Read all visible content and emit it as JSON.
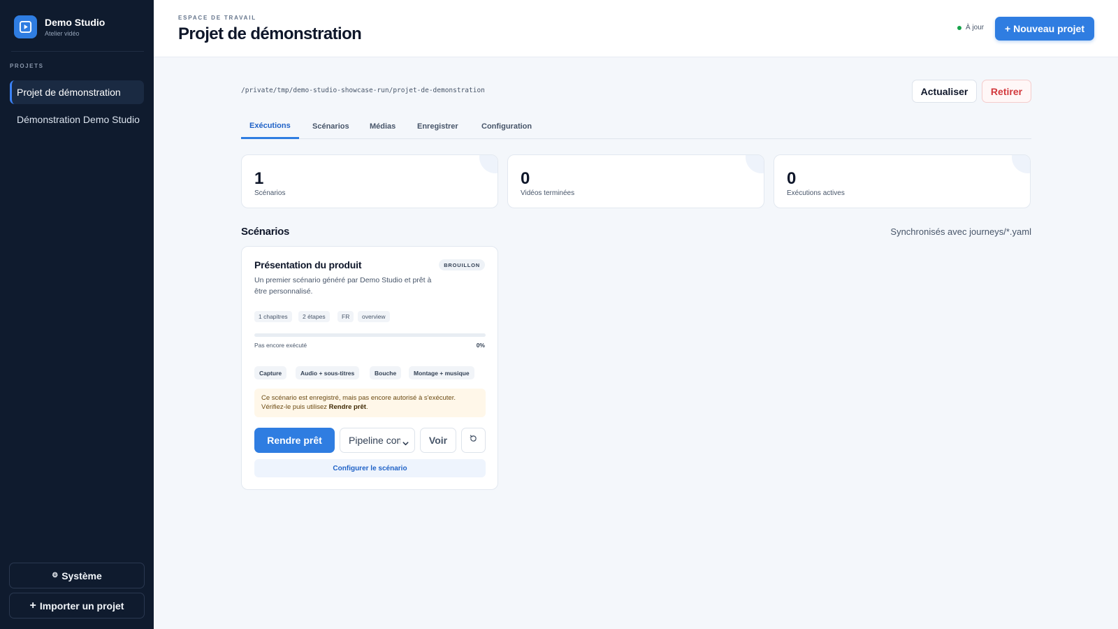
{
  "sidebar": {
    "brand_name": "Demo Studio",
    "brand_sub": "Atelier vidéo",
    "section_label": "PROJETS",
    "items": [
      {
        "label": "Projet de démonstration",
        "active": true
      },
      {
        "label": "Démonstration Demo Studio",
        "active": false
      }
    ],
    "system_label": "Système",
    "system_icon": "⚙",
    "import_label": "Importer un projet",
    "import_icon": "+"
  },
  "header": {
    "eyebrow": "ESPACE DE TRAVAIL",
    "title": "Projet de démonstration",
    "status_text": "À jour",
    "status_color": "#16a34a",
    "new_project_label": "+ Nouveau projet"
  },
  "main": {
    "path": "/private/tmp/demo-studio-showcase-run/projet-de-demonstration",
    "refresh_label": "Actualiser",
    "retire_label": "Retirer",
    "tabs": [
      {
        "label": "Exécutions",
        "active": true
      },
      {
        "label": "Scénarios",
        "active": false
      },
      {
        "label": "Médias",
        "active": false
      },
      {
        "label": "Enregistrer",
        "active": false
      },
      {
        "label": "Configuration",
        "active": false
      }
    ],
    "stats": [
      {
        "value": "1",
        "label": "Scénarios"
      },
      {
        "value": "0",
        "label": "Vidéos terminées"
      },
      {
        "value": "0",
        "label": "Exécutions actives"
      }
    ],
    "section_title": "Scénarios",
    "section_note": "Synchronisés avec journeys/*.yaml"
  },
  "scenario": {
    "title": "Présentation du produit",
    "badge": "BROUILLON",
    "description": "Un premier scénario généré par Demo Studio et prêt à être personnalisé.",
    "chips": [
      "1 chapitres",
      "2 étapes",
      "FR",
      "overview"
    ],
    "progress": 0,
    "progress_label": "Pas encore exécuté",
    "progress_pct": "0%",
    "stages": [
      "Capture",
      "Audio + sous-titres",
      "Bouche",
      "Montage + musique"
    ],
    "warning_text": "Ce scénario est enregistré, mais pas encore autorisé à s'exécuter. Vérifiez-le puis utilisez ",
    "warning_bold": "Rendre prêt",
    "warning_end": ".",
    "ready_label": "Rendre prêt",
    "pipeline_value": "Pipeline com",
    "view_label": "Voir",
    "configure_label": "Configurer le scénario"
  },
  "colors": {
    "accent": "#2f7de1",
    "sidebar_bg": "#0f1b2e",
    "danger": "#d2393d",
    "warning_bg": "#fff7e9"
  }
}
